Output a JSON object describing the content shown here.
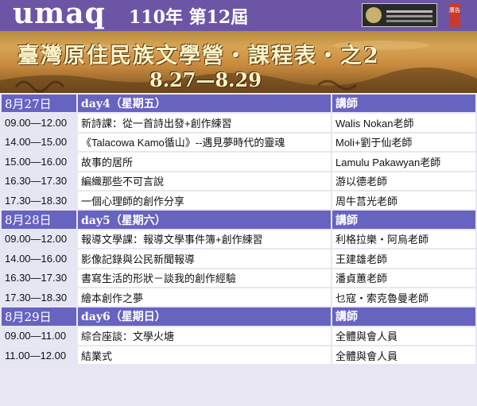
{
  "header": {
    "logo": "umaq",
    "edition": "110年 第12屆",
    "ad_tag": "廣告",
    "title": "臺灣原住民族文學營・課程表・之2",
    "dates": "8.27—8.29"
  },
  "days": [
    {
      "date": "8月27日",
      "label": "day4（星期五）",
      "instructor_header": "講師",
      "sessions": [
        {
          "time": "09.00—12.00",
          "course": "新詩課：從一首詩出發+創作練習",
          "teacher": "Walis Nokan老師"
        },
        {
          "time": "14.00—15.00",
          "course": "《Talacowa Kamo循山》--遇見夢時代的靈魂",
          "teacher": "Moli+劉于仙老師"
        },
        {
          "time": "15.00—16.00",
          "course": "故事的居所",
          "teacher": "Lamulu Pakawyan老師"
        },
        {
          "time": "16.30—17.30",
          "course": "編織那些不可言說",
          "teacher": "游以德老師"
        },
        {
          "time": "17.30—18.30",
          "course": "一個心理師的創作分享",
          "teacher": "周牛莒光老師"
        }
      ]
    },
    {
      "date": "8月28日",
      "label": "day5（星期六）",
      "instructor_header": "講師",
      "sessions": [
        {
          "time": "09.00—12.00",
          "course": "報導文學課：報導文學事件簿+創作練習",
          "teacher": "利格拉樂・阿烏老師"
        },
        {
          "time": "14.00—16.00",
          "course": "影像記錄與公民新聞報導",
          "teacher": "王建雄老師"
        },
        {
          "time": "16.30—17.30",
          "course": "書寫生活的形狀－談我的創作經驗",
          "teacher": "潘貞蕙老師"
        },
        {
          "time": "17.30—18.30",
          "course": "繪本創作之夢",
          "teacher": "乜寇・索克魯曼老師"
        }
      ]
    },
    {
      "date": "8月29日",
      "label": "day6（星期日）",
      "instructor_header": "講師",
      "sessions": [
        {
          "time": "09.00—11.00",
          "course": "綜合座談：文學火塘",
          "teacher": "全體與會人員"
        },
        {
          "time": "11.00—12.00",
          "course": "結業式",
          "teacher": "全體與會人員"
        }
      ]
    }
  ]
}
